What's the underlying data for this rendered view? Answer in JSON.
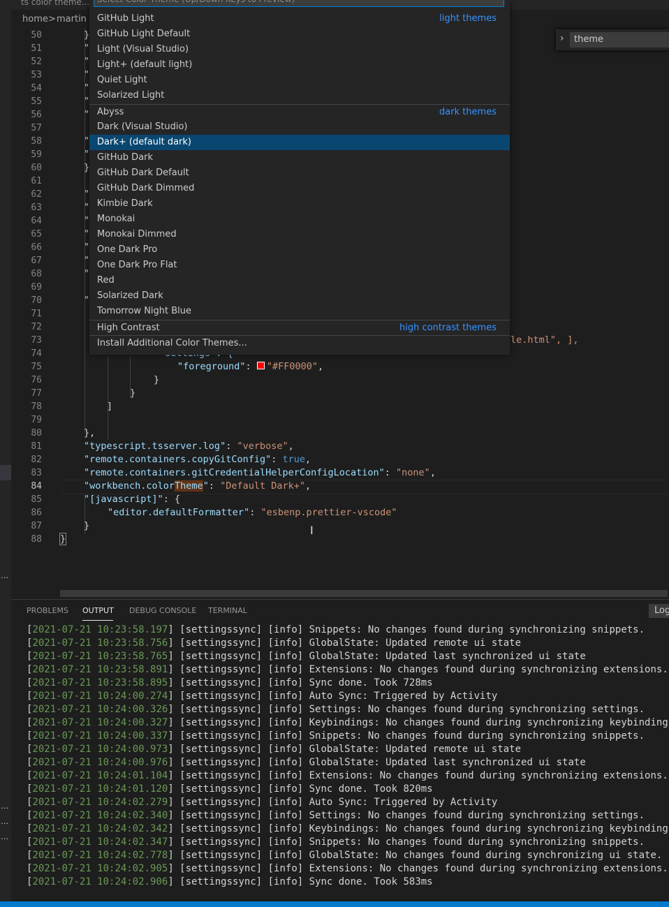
{
  "window": {
    "tab_title": "ts  color theme..."
  },
  "breadcrumb": {
    "home": "home",
    "sep": ">",
    "user": "martin"
  },
  "editor": {
    "line_numbers": [
      "50",
      "51",
      "52",
      "53",
      "54",
      "55",
      "56",
      "57",
      "58",
      "59",
      "60",
      "61",
      "62",
      "63",
      "64",
      "65",
      "66",
      "67",
      "68",
      "69",
      "70",
      "71",
      "72",
      "73",
      "74",
      "75",
      "76",
      "77",
      "78",
      "79",
      "80",
      "81",
      "82",
      "83",
      "84",
      "85",
      "86",
      "87",
      "88"
    ],
    "active_line": "84",
    "code": {
      "l50": "}",
      "l51": "\"",
      "l52": "\"",
      "l53": "\"",
      "l54": "\"",
      "l55": "\"",
      "l56": "\"",
      "l58": "\"",
      "l59": "\"",
      "l60": "}",
      "l62": "\"",
      "l63": "\"",
      "l64": "\"",
      "l65": "\"",
      "l66": "\"",
      "l67": "\"",
      "l68": "\"",
      "l70": "\"",
      "l73_tail": "le.html\", ],",
      "l74": "\"settings\": {",
      "l75_key": "\"foreground\"",
      "l75_val": "\"#FF0000\"",
      "l76": "}",
      "l77": "}",
      "l78": "]",
      "l80": "},",
      "l81_key": "\"typescript.tsserver.log\"",
      "l81_val": "\"verbose\"",
      "l82_key": "\"remote.containers.copyGitConfig\"",
      "l82_val": "true",
      "l83_key": "\"remote.containers.gitCredentialHelperConfigLocation\"",
      "l83_val": "\"none\"",
      "l84_key_a": "\"workbench.color",
      "l84_key_hl": "Theme",
      "l84_key_b": "\"",
      "l84_val": "\"Default Dark+\"",
      "l85_key": "\"[javascript]\"",
      "l85_rest": ": {",
      "l86_key": "\"editor.defaultFormatter\"",
      "l86_val": "\"esbenp.prettier-vscode\"",
      "l87": "}",
      "l88": "}",
      "colon": ": ",
      "comma": ","
    }
  },
  "find_widget": {
    "value": "theme"
  },
  "quick_pick": {
    "placeholder": "Select Color Theme (Up/Down Keys to Preview)",
    "groups": {
      "light": "light themes",
      "dark": "dark themes",
      "hc": "high contrast themes"
    },
    "items": [
      "GitHub Light",
      "GitHub Light Default",
      "Light (Visual Studio)",
      "Light+ (default light)",
      "Quiet Light",
      "Solarized Light",
      "Abyss",
      "Dark (Visual Studio)",
      "Dark+ (default dark)",
      "GitHub Dark",
      "GitHub Dark Default",
      "GitHub Dark Dimmed",
      "Kimbie Dark",
      "Monokai",
      "Monokai Dimmed",
      "One Dark Pro",
      "One Dark Pro Flat",
      "Red",
      "Solarized Dark",
      "Tomorrow Night Blue",
      "High Contrast",
      "Install Additional Color Themes..."
    ],
    "selected": "Dark+ (default dark)"
  },
  "panel": {
    "tabs": [
      "PROBLEMS",
      "OUTPUT",
      "DEBUG CONSOLE",
      "TERMINAL"
    ],
    "active_tab": "OUTPUT",
    "log_select": "Log",
    "output": [
      {
        "ts": "2021-07-21 10:23:58.197",
        "msg": "] [settingssync] [info] Snippets: No changes found during synchronizing snippets."
      },
      {
        "ts": "2021-07-21 10:23:58.756",
        "msg": "] [settingssync] [info] GlobalState: Updated remote ui state"
      },
      {
        "ts": "2021-07-21 10:23:58.765",
        "msg": "] [settingssync] [info] GlobalState: Updated last synchronized ui state"
      },
      {
        "ts": "2021-07-21 10:23:58.891",
        "msg": "] [settingssync] [info] Extensions: No changes found during synchronizing extensions."
      },
      {
        "ts": "2021-07-21 10:23:58.895",
        "msg": "] [settingssync] [info] Sync done. Took 728ms"
      },
      {
        "ts": "2021-07-21 10:24:00.274",
        "msg": "] [settingssync] [info] Auto Sync: Triggered by Activity"
      },
      {
        "ts": "2021-07-21 10:24:00.326",
        "msg": "] [settingssync] [info] Settings: No changes found during synchronizing settings."
      },
      {
        "ts": "2021-07-21 10:24:00.327",
        "msg": "] [settingssync] [info] Keybindings: No changes found during synchronizing keybindings"
      },
      {
        "ts": "2021-07-21 10:24:00.337",
        "msg": "] [settingssync] [info] Snippets: No changes found during synchronizing snippets."
      },
      {
        "ts": "2021-07-21 10:24:00.973",
        "msg": "] [settingssync] [info] GlobalState: Updated remote ui state"
      },
      {
        "ts": "2021-07-21 10:24:00.976",
        "msg": "] [settingssync] [info] GlobalState: Updated last synchronized ui state"
      },
      {
        "ts": "2021-07-21 10:24:01.104",
        "msg": "] [settingssync] [info] Extensions: No changes found during synchronizing extensions."
      },
      {
        "ts": "2021-07-21 10:24:01.120",
        "msg": "] [settingssync] [info] Sync done. Took 820ms"
      },
      {
        "ts": "2021-07-21 10:24:02.279",
        "msg": "] [settingssync] [info] Auto Sync: Triggered by Activity"
      },
      {
        "ts": "2021-07-21 10:24:02.340",
        "msg": "] [settingssync] [info] Settings: No changes found during synchronizing settings."
      },
      {
        "ts": "2021-07-21 10:24:02.342",
        "msg": "] [settingssync] [info] Keybindings: No changes found during synchronizing keybindings"
      },
      {
        "ts": "2021-07-21 10:24:02.347",
        "msg": "] [settingssync] [info] Snippets: No changes found during synchronizing snippets."
      },
      {
        "ts": "2021-07-21 10:24:02.778",
        "msg": "] [settingssync] [info] GlobalState: No changes found during synchronizing ui state."
      },
      {
        "ts": "2021-07-21 10:24:02.905",
        "msg": "] [settingssync] [info] Extensions: No changes found during synchronizing extensions."
      },
      {
        "ts": "2021-07-21 10:24:02.906",
        "msg": "] [settingssync] [info] Sync done. Took 583ms"
      }
    ]
  },
  "colors": {
    "accent": "#007acc",
    "selection": "#094771",
    "group_label": "#3794ff",
    "timestamp": "#6a9955"
  }
}
